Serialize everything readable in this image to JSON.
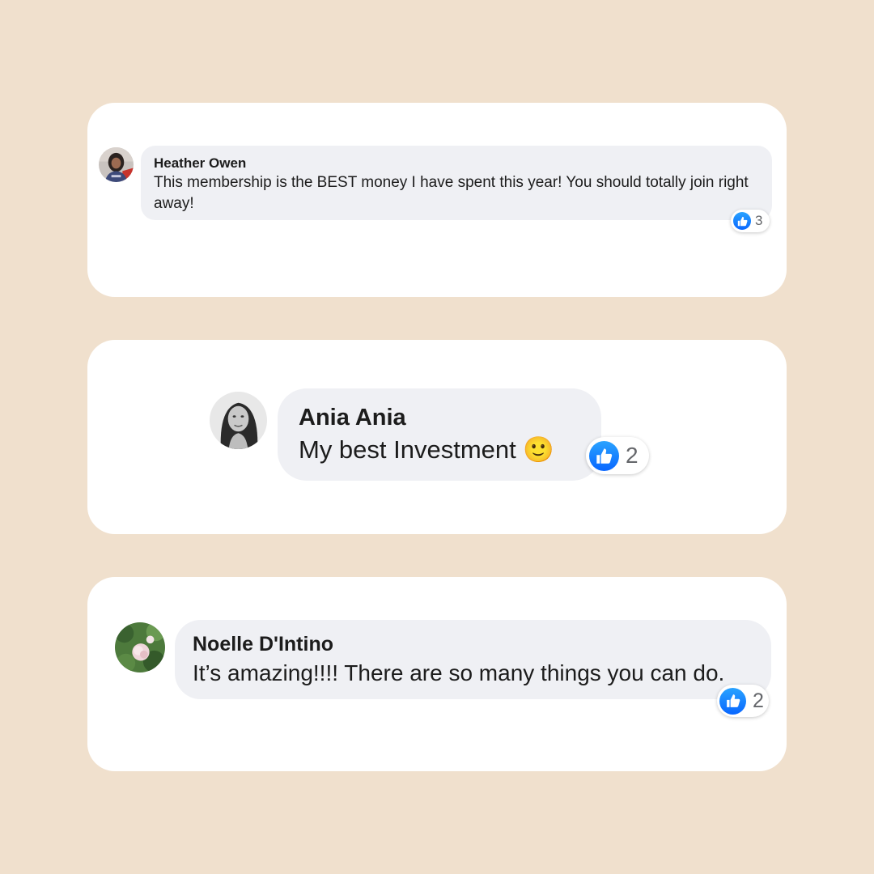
{
  "colors": {
    "background": "#f0e0cd",
    "card": "#ffffff",
    "bubble": "#eff0f4",
    "like_blue": "#0866ff",
    "count_gray": "#65676b"
  },
  "comments": [
    {
      "author": "Heather Owen",
      "text": "This membership is the BEST money I have spent this year! You should totally join right away!",
      "reaction_icon": "thumbs-up-icon",
      "reaction_count": "3"
    },
    {
      "author": "Ania Ania",
      "text": "My best Investment",
      "emoji": "🙂",
      "reaction_icon": "thumbs-up-icon",
      "reaction_count": "2"
    },
    {
      "author": "Noelle D'Intino",
      "text": "It’s amazing!!!! There are so many things you can do.",
      "reaction_icon": "thumbs-up-icon",
      "reaction_count": "2"
    }
  ]
}
